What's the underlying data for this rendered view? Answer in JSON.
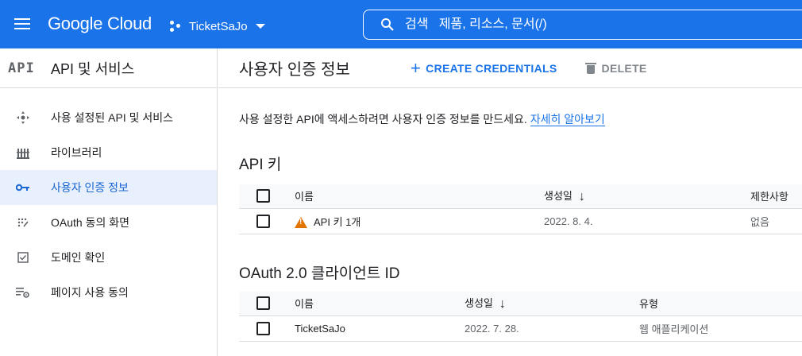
{
  "header": {
    "logo": "Google Cloud",
    "project": "TicketSaJo",
    "search_placeholder": "검색   제품, 리소스, 문서(/)"
  },
  "sidebar": {
    "badge": "API",
    "title": "API 및 서비스",
    "items": [
      {
        "label": "사용 설정된 API 및 서비스",
        "icon": "api-nodes-icon",
        "active": false
      },
      {
        "label": "라이브러리",
        "icon": "library-icon",
        "active": false
      },
      {
        "label": "사용자 인증 정보",
        "icon": "key-icon",
        "active": true
      },
      {
        "label": "OAuth 동의 화면",
        "icon": "oauth-consent-icon",
        "active": false
      },
      {
        "label": "도메인 확인",
        "icon": "checkbox-icon",
        "active": false
      },
      {
        "label": "페이지 사용 동의",
        "icon": "settings-list-icon",
        "active": false
      }
    ]
  },
  "main": {
    "title": "사용자 인증 정보",
    "create_label": "CREATE CREDENTIALS",
    "delete_label": "DELETE",
    "intro_text": "사용 설정한 API에 액세스하려면 사용자 인증 정보를 만드세요. ",
    "learn_more": "자세히 알아보기"
  },
  "api_keys": {
    "title": "API 키",
    "columns": [
      "이름",
      "생성일",
      "제한사항"
    ],
    "rows": [
      {
        "name": "API 키 1개",
        "created": "2022. 8. 4.",
        "restriction": "없음",
        "warning": true
      }
    ]
  },
  "oauth": {
    "title": "OAuth 2.0 클라이언트 ID",
    "columns": [
      "이름",
      "생성일",
      "유형"
    ],
    "rows": [
      {
        "name": "TicketSaJo",
        "created": "2022. 7. 28.",
        "type": "웹 애플리케이션"
      }
    ]
  },
  "colors": {
    "brand": "#1a73e8",
    "active_bg": "#e8f0fe",
    "warning": "#e37400"
  }
}
